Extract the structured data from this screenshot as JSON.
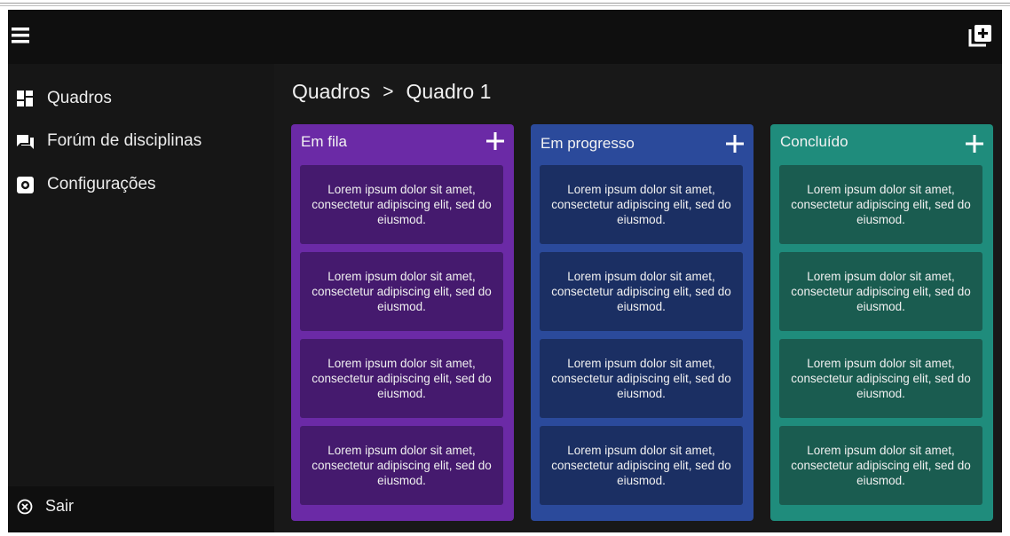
{
  "header": {
    "menu_icon": "hamburger-menu-icon",
    "add_board_icon": "add-board-icon"
  },
  "sidebar": {
    "items": [
      {
        "label": "Quadros",
        "icon": "dashboard-icon"
      },
      {
        "label": "Forúm de disciplinas",
        "icon": "forum-icon"
      },
      {
        "label": "Configurações",
        "icon": "settings-icon"
      }
    ],
    "logout": {
      "label": "Sair",
      "icon": "close-circle-icon"
    }
  },
  "breadcrumb": {
    "root": "Quadros",
    "separator": ">",
    "current": "Quadro 1"
  },
  "columns": [
    {
      "title": "Em fila",
      "color": "#6b2aa6",
      "card_color": "#451a6e",
      "cards": [
        "Lorem ipsum dolor sit amet, consectetur adipiscing elit, sed do eiusmod.",
        "Lorem ipsum dolor sit amet, consectetur adipiscing elit, sed do eiusmod.",
        "Lorem ipsum dolor sit amet, consectetur adipiscing elit, sed do eiusmod.",
        "Lorem ipsum dolor sit amet, consectetur adipiscing elit, sed do eiusmod."
      ]
    },
    {
      "title": "Em progresso",
      "color": "#2b4a9b",
      "card_color": "#1b2f63",
      "cards": [
        "Lorem ipsum dolor sit amet, consectetur adipiscing elit, sed do eiusmod.",
        "Lorem ipsum dolor sit amet, consectetur adipiscing elit, sed do eiusmod.",
        "Lorem ipsum dolor sit amet, consectetur adipiscing elit, sed do eiusmod.",
        "Lorem ipsum dolor sit amet, consectetur adipiscing elit, sed do eiusmod."
      ]
    },
    {
      "title": "Concluído",
      "color": "#1f8c7c",
      "card_color": "#1a5c50",
      "cards": [
        "Lorem ipsum dolor sit amet, consectetur adipiscing elit, sed do eiusmod.",
        "Lorem ipsum dolor sit amet, consectetur adipiscing elit, sed do eiusmod.",
        "Lorem ipsum dolor sit amet, consectetur adipiscing elit, sed do eiusmod.",
        "Lorem ipsum dolor sit amet, consectetur adipiscing elit, sed do eiusmod."
      ]
    }
  ],
  "colors": {
    "topbar": "#0f0f0f",
    "background": "#181818",
    "text": "#f0f0f0"
  }
}
